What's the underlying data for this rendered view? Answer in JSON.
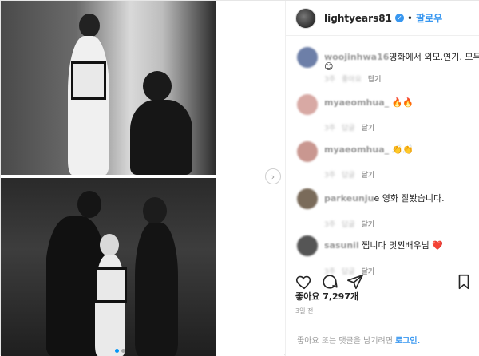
{
  "header": {
    "username": "lightyears81",
    "separator": "•",
    "follow_label": "팔로우"
  },
  "comments": [
    {
      "user": "woojinhwa16",
      "text": "영화에서 외모.연기. 모두",
      "emoji": "😊",
      "time": "3주",
      "likes": "좋아요",
      "reply": "답기",
      "avatar_color": "#6d7fa8"
    },
    {
      "user": "myaeomhua_",
      "text": "",
      "emoji": "🔥🔥",
      "time": "3주",
      "likes": "답글",
      "reply": "달기",
      "avatar_color": "#d8a9a4"
    },
    {
      "user": "myaeomhua_",
      "text": "",
      "emoji": "👏👏",
      "time": "3주",
      "likes": "답글",
      "reply": "달기",
      "avatar_color": "#c99790"
    },
    {
      "user": "parkeunju",
      "text": "e 영화 잘봤습니다.",
      "emoji": "",
      "time": "3주",
      "likes": "답글",
      "reply": "달기",
      "avatar_color": "#7a6b5a"
    },
    {
      "user": "sasunil",
      "text": "쩝니다 멋찐배우님",
      "emoji": "❤️",
      "time": "3주",
      "likes": "답글",
      "reply": "달기",
      "avatar_color": "#555555"
    }
  ],
  "actions": {
    "like_icon": "heart-icon",
    "comment_icon": "comment-icon",
    "share_icon": "share-icon",
    "save_icon": "bookmark-icon"
  },
  "likes_text": "좋아요 7,297개",
  "time_text": "3일 전",
  "footer": {
    "prompt": "좋아요 또는 댓글을 남기려면",
    "login_label": "로그인."
  },
  "carousel": {
    "next_label": "›",
    "slide_count": 2,
    "active_slide": 1
  }
}
